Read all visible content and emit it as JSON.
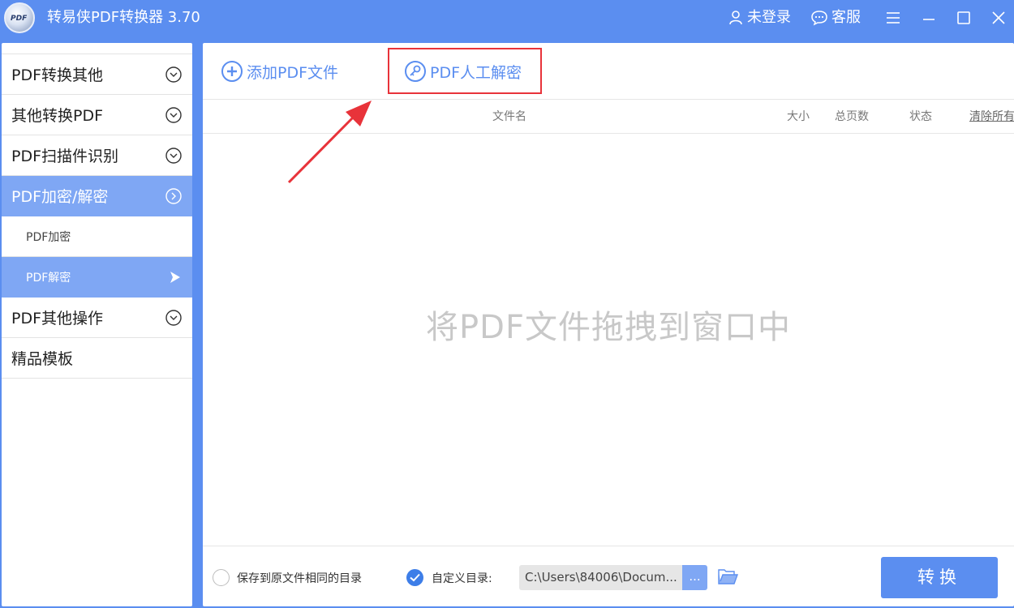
{
  "app": {
    "title": "转易侠PDF转换器 3.70",
    "logo_text": "PDF",
    "login_label": "未登录",
    "service_label": "客服"
  },
  "sidebar": {
    "items": [
      {
        "label": "PDF转换其他",
        "state": "collapsed"
      },
      {
        "label": "其他转换PDF",
        "state": "collapsed"
      },
      {
        "label": "PDF扫描件识别",
        "state": "collapsed"
      },
      {
        "label": "PDF加密/解密",
        "state": "expanded"
      },
      {
        "label": "PDF其他操作",
        "state": "collapsed"
      },
      {
        "label": "精品模板",
        "state": "none"
      }
    ],
    "sub_items": [
      {
        "label": "PDF加密"
      },
      {
        "label": "PDF解密"
      }
    ]
  },
  "toolbar": {
    "add_label": "添加PDF文件",
    "manual_decrypt_label": "PDF人工解密"
  },
  "table": {
    "headers": {
      "filename": "文件名",
      "size": "大小",
      "pages": "总页数",
      "status": "状态",
      "clear_all": "清除所有"
    },
    "rows": []
  },
  "drop_hint": "将PDF文件拖拽到窗口中",
  "output": {
    "same_dir_label": "保存到原文件相同的目录",
    "custom_dir_label": "自定义目录:",
    "path_value": "C:\\Users\\84006\\Docum...",
    "browse_label": "...",
    "convert_label": "转换",
    "same_dir_selected": false,
    "custom_dir_selected": true
  },
  "colors": {
    "accent": "#5b8ef0",
    "sidebar_active": "#7fa7f4",
    "highlight": "#e8333a"
  }
}
